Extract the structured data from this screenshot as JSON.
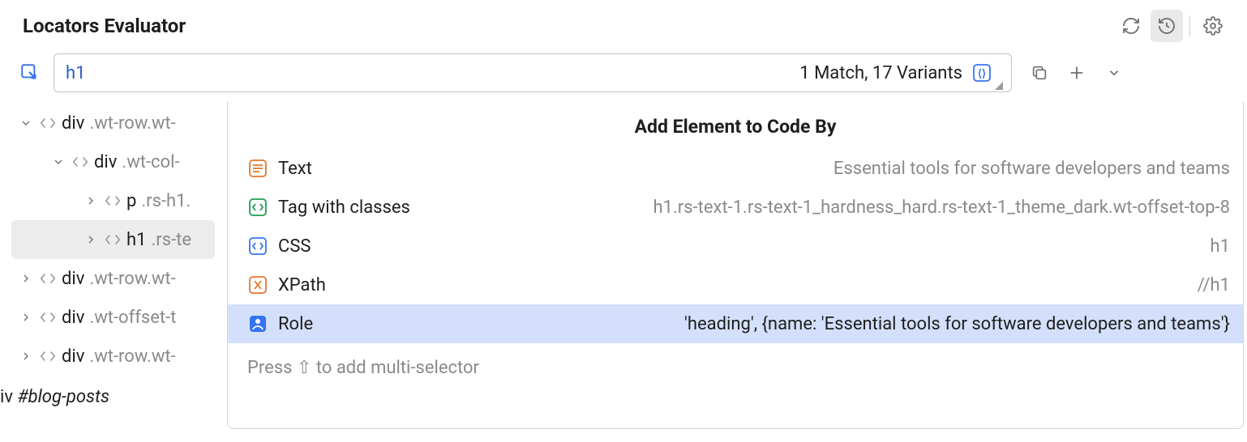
{
  "title": "Locators Evaluator",
  "search": {
    "value": "h1",
    "matchText": "1 Match, 17 Variants"
  },
  "tree": {
    "nodes": [
      {
        "indent": 0,
        "caret": "down",
        "tag": "div",
        "classes": ".wt-row.wt-"
      },
      {
        "indent": 1,
        "caret": "down",
        "tag": "div",
        "classes": ".wt-col-"
      },
      {
        "indent": 2,
        "caret": "right",
        "tag": "p",
        "classes": ".rs-h1."
      },
      {
        "indent": 2,
        "caret": "right",
        "tag": "h1",
        "classes": ".rs-te",
        "selected": true
      },
      {
        "indent": 0,
        "caret": "right",
        "tag": "div",
        "classes": ".wt-row.wt-"
      },
      {
        "indent": 0,
        "caret": "right",
        "tag": "div",
        "classes": ".wt-offset-t"
      },
      {
        "indent": 0,
        "caret": "right",
        "tag": "div",
        "classes": ".wt-row.wt-"
      }
    ],
    "footer": {
      "tag": "iv",
      "id": "#blog-posts"
    }
  },
  "popup": {
    "title": "Add Element to Code By",
    "options": [
      {
        "kind": "text",
        "label": "Text",
        "value": "Essential tools for software developers and teams"
      },
      {
        "kind": "tag",
        "label": "Tag with classes",
        "value": "h1.rs-text-1.rs-text-1_hardness_hard.rs-text-1_theme_dark.wt-offset-top-8"
      },
      {
        "kind": "css",
        "label": "CSS",
        "value": "h1"
      },
      {
        "kind": "xpath",
        "label": "XPath",
        "value": "//h1"
      },
      {
        "kind": "role",
        "label": "Role",
        "value": "'heading', {name: 'Essential tools for software developers and teams'}",
        "highlight": true
      }
    ],
    "footer": "Press ⇧ to add multi-selector"
  }
}
